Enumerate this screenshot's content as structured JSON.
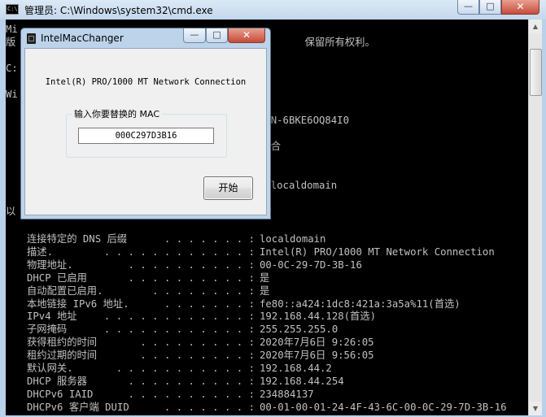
{
  "cmd": {
    "title": "管理员: C:\\Windows\\system32\\cmd.exe",
    "icon_text": "C:\\",
    "buttons": {
      "minimize": "—",
      "maximize": "□",
      "close": "✕"
    }
  },
  "console": {
    "top_lines": [
      "Mi                                                      ",
      "版                                                保留所有权利。",
      "",
      "C:",
      "",
      "Wi",
      "",
      "",
      "                                            N-6BKE6OQ84I0",
      "",
      "                                            合",
      "",
      "",
      "                                            localdomain",
      "",
      "以"
    ],
    "rows": [
      {
        "label": "连接特定的 DNS 后缀",
        "dots": " . . . . . . . :",
        "value": "localdomain"
      },
      {
        "label": "描述.",
        "dots": " . . . . . . . . . . . . :",
        "value": "Intel(R) PRO/1000 MT Network Connection"
      },
      {
        "label": "物理地址.",
        "dots": " . . . . . . . . . . :",
        "value": "00-0C-29-7D-3B-16"
      },
      {
        "label": "DHCP 已启用",
        "dots": " . . . . . . . . . . :",
        "value": "是"
      },
      {
        "label": "自动配置已启用.",
        "dots": " . . . . . . . . :",
        "value": "是"
      },
      {
        "label": "本地链接 IPv6 地址.",
        "dots": " . . . . . . . :",
        "value": "fe80::a424:1dc8:421a:3a5a%11(首选)"
      },
      {
        "label": "IPv4 地址",
        "dots": " . . . . . . . . . . . . :",
        "value": "192.168.44.128(首选)"
      },
      {
        "label": "子网掩码",
        "dots": " . . . . . . . . . . . . :",
        "value": "255.255.255.0"
      },
      {
        "label": "获得租约的时间",
        "dots": " . . . . . . . . . :",
        "value": "2020年7月6日 9:26:05"
      },
      {
        "label": "租约过期的时间",
        "dots": " . . . . . . . . . :",
        "value": "2020年7月6日 9:56:05"
      },
      {
        "label": "默认网关.",
        "dots": " . . . . . . . . . . . :",
        "value": "192.168.44.2"
      },
      {
        "label": "DHCP 服务器",
        "dots": " . . . . . . . . . . :",
        "value": "192.168.44.254"
      },
      {
        "label": "DHCPv6 IAID",
        "dots": " . . . . . . . . . . :",
        "value": "234884137"
      },
      {
        "label": "DHCPv6 客户端 DUID",
        "dots": " . . . . . . . :",
        "value": "00-01-00-01-24-4F-43-6C-00-0C-29-7D-3B-16"
      }
    ]
  },
  "dialog": {
    "title": "IntelMacChanger",
    "adapter_name": "Intel(R) PRO/1000 MT Network Connection",
    "group_label": "输入你要替换的 MAC",
    "mac_value": "000C297D3B16",
    "start_label": "开始",
    "buttons": {
      "minimize": "—",
      "maximize": "□",
      "close": "✕"
    }
  }
}
